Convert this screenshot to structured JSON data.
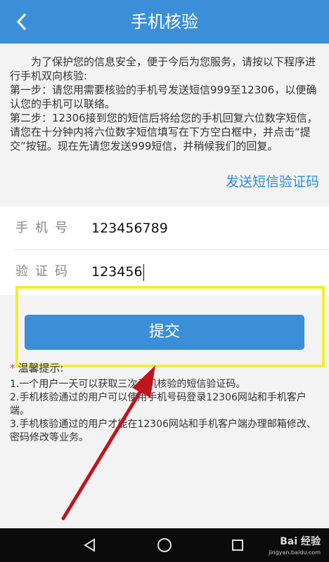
{
  "header": {
    "title": "手机核验"
  },
  "info": {
    "lines": [
      "为了保护您的信息安全，便于今后为您服务，请按以下程序进行手机双向核验:",
      "第一步：请您用需要核验的手机号发送短信999至12306，以便确认您的手机可以联络。",
      "第二步：12306接到您的短信后将给您的手机回复六位数字短信，请您在十分钟内将六位数字短信填写在下方空白框中，并点击“提交”按钮。现在先请您发送999短信，并稍候我们的回复。"
    ]
  },
  "send_code_label": "发送短信验证码",
  "form": {
    "phone_label": "手机号",
    "phone_value": "123456789",
    "code_label": "验证码",
    "code_value": "123456"
  },
  "submit_label": "提交",
  "tips": {
    "title": "温馨提示:",
    "items": [
      "1.一个用户一天可以获取三次手机核验的短信验证码。",
      "2.手机核验通过的用户可以使用手机号码登录12306网站和手机客户端。",
      "3.手机核验通过的用户才能在12306网站和手机客户端办理邮箱修改、密码修改等业务。"
    ]
  },
  "watermark": {
    "brand": "Bai 经验",
    "url": "jingyan.baidu.com"
  },
  "colors": {
    "header": "#3b8fd9",
    "link": "#2f8bd6",
    "highlight": "#f3ef2b",
    "arrow": "#c0141e"
  },
  "icons": {
    "back": "chevron-left-icon",
    "nav_back": "triangle-back-icon",
    "nav_home": "circle-home-icon",
    "nav_recent": "square-recent-icon"
  }
}
